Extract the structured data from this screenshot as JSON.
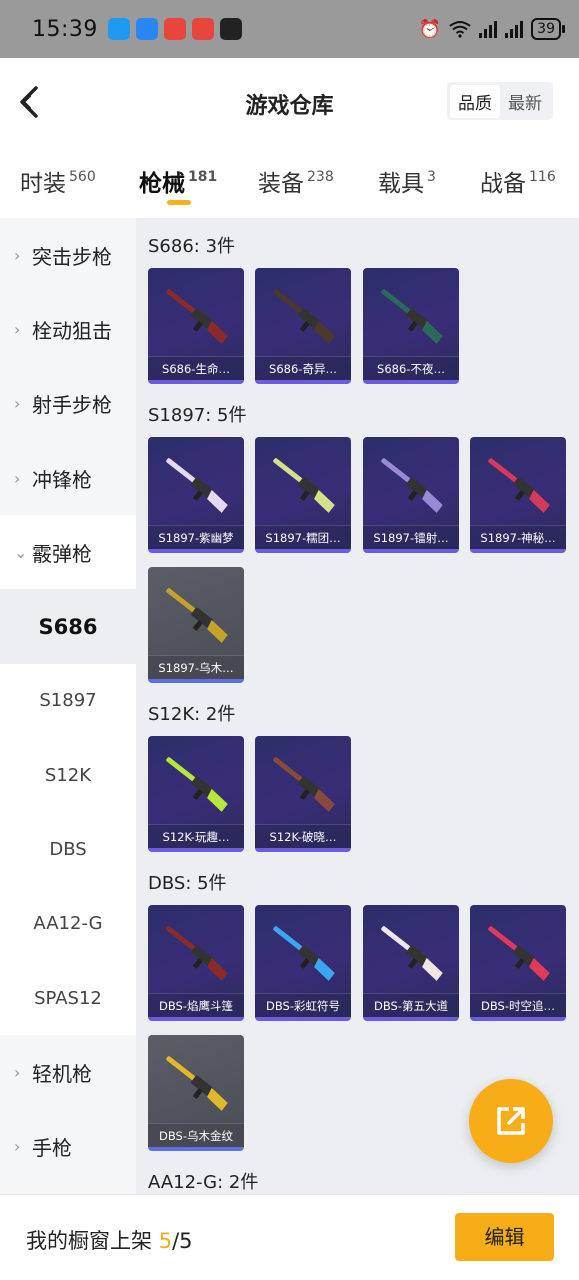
{
  "status_bar": {
    "time": "15:39",
    "battery": "39",
    "app_icon_colors": [
      "#1e9bf0",
      "#2b86f5",
      "#e8453c",
      "#e8453c",
      "#222222"
    ]
  },
  "header": {
    "title": "游戏仓库",
    "sort_options": [
      "品质",
      "最新"
    ],
    "active_sort": "品质"
  },
  "tabs": [
    {
      "label": "时装",
      "count": "560"
    },
    {
      "label": "枪械",
      "count": "181"
    },
    {
      "label": "装备",
      "count": "238"
    },
    {
      "label": "载具",
      "count": "3"
    },
    {
      "label": "战备",
      "count": "116"
    }
  ],
  "active_tab": "枪械",
  "accent_color": "#f6ad17",
  "sidebar": {
    "items": [
      {
        "label": "突击步枪",
        "type": "category"
      },
      {
        "label": "栓动狙击",
        "type": "category"
      },
      {
        "label": "射手步枪",
        "type": "category"
      },
      {
        "label": "冲锋枪",
        "type": "category"
      },
      {
        "label": "霰弹枪",
        "type": "category",
        "expanded": true
      },
      {
        "label": "S686",
        "type": "sub",
        "selected": true
      },
      {
        "label": "S1897",
        "type": "sub"
      },
      {
        "label": "S12K",
        "type": "sub"
      },
      {
        "label": "DBS",
        "type": "sub"
      },
      {
        "label": "AA12-G",
        "type": "sub"
      },
      {
        "label": "SPAS12",
        "type": "sub"
      },
      {
        "label": "轻机枪",
        "type": "category"
      },
      {
        "label": "手枪",
        "type": "category"
      }
    ]
  },
  "groups": [
    {
      "title": "S686: 3件",
      "items": [
        {
          "label": "S686-生命…",
          "color": "#8a2a2a",
          "style": "purple"
        },
        {
          "label": "S686-奇异…",
          "color": "#4a3a2a",
          "style": "purple"
        },
        {
          "label": "S686-不夜…",
          "color": "#2a6a5a",
          "style": "purple"
        }
      ]
    },
    {
      "title": "S1897: 5件",
      "items": [
        {
          "label": "S1897-紫幽梦",
          "color": "#e6d8ee",
          "style": "purple"
        },
        {
          "label": "S1897-糯团…",
          "color": "#d6e08a",
          "style": "purple"
        },
        {
          "label": "S1897-镭射…",
          "color": "#9a8ad6",
          "style": "purple"
        },
        {
          "label": "S1897-神秘…",
          "color": "#d63a5a",
          "style": "purple"
        },
        {
          "label": "S1897-乌木…",
          "color": "#c6a22a",
          "style": "grey"
        }
      ]
    },
    {
      "title": "S12K: 2件",
      "items": [
        {
          "label": "S12K-玩趣…",
          "color": "#b6e83a",
          "style": "purple"
        },
        {
          "label": "S12K-破晓…",
          "color": "#8a4a3a",
          "style": "purple"
        }
      ]
    },
    {
      "title": "DBS: 5件",
      "items": [
        {
          "label": "DBS-焰鹰斗篷",
          "color": "#8a2a2a",
          "style": "purple"
        },
        {
          "label": "DBS-彩虹符号",
          "color": "#3aa8f0",
          "style": "purple"
        },
        {
          "label": "DBS-第五大道",
          "color": "#f0e6e6",
          "style": "purple"
        },
        {
          "label": "DBS-时空追…",
          "color": "#e03a5a",
          "style": "purple"
        },
        {
          "label": "DBS-乌木金纹",
          "color": "#e0b82a",
          "style": "grey"
        }
      ]
    },
    {
      "title": "AA12-G: 2件",
      "items": []
    }
  ],
  "bottom_bar": {
    "label": "我的橱窗上架",
    "count_current": "5",
    "count_total": "/5",
    "edit_button": "编辑"
  }
}
